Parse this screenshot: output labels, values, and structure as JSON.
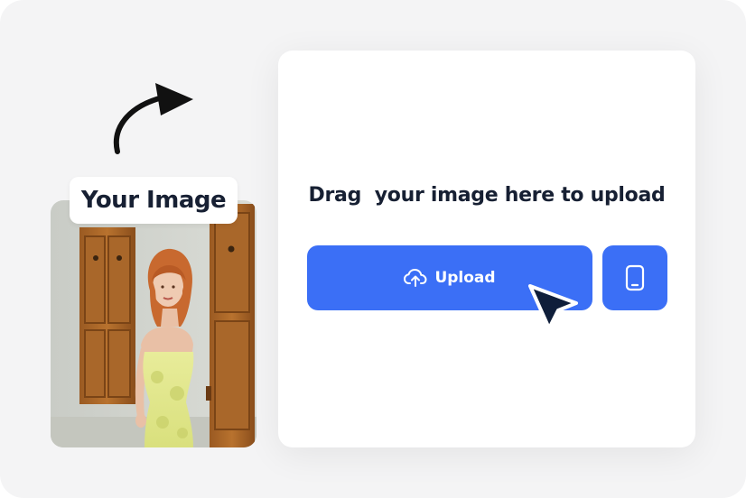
{
  "tag": {
    "label": "Your Image"
  },
  "card": {
    "title": "Drag  your image here to upload",
    "upload_label": "Upload"
  },
  "icons": {
    "arrow": "curved-arrow-icon",
    "upload": "cloud-upload-icon",
    "phone": "smartphone-icon",
    "cursor": "mouse-cursor-icon"
  },
  "colors": {
    "accent": "#3b6ff6",
    "text": "#172033",
    "background": "#f4f4f5",
    "card": "#ffffff",
    "cursor": "#0f1e3a"
  }
}
